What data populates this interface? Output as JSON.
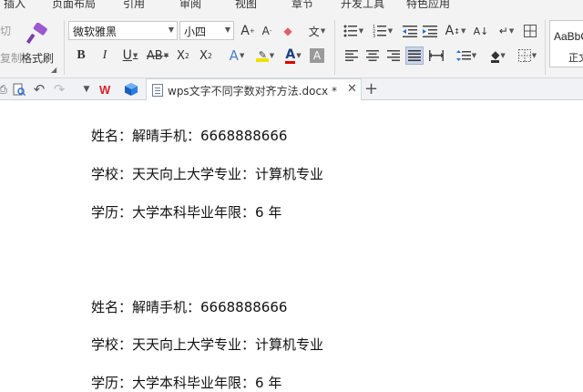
{
  "menu": [
    "插入",
    "页面布局",
    "引用",
    "审阅",
    "视图",
    "章节",
    "开发工具",
    "特色应用"
  ],
  "clipboard": {
    "cut": "切",
    "copy": "复制",
    "format_painter": "格式刷"
  },
  "font": {
    "name": "微软雅黑",
    "size": "小四"
  },
  "styles": {
    "preview": "AaBbC",
    "normal": "正文"
  },
  "document_tab": {
    "title": "wps文字不同字数对齐方法.docx *"
  },
  "document": {
    "lines": [
      "姓名：解晴手机：6668888666",
      "学校：天天向上大学专业：计算机专业",
      "学历：大学本科毕业年限：6 年",
      "姓名：解晴手机：6668888666",
      "学校：天天向上大学专业：计算机专业",
      "学历：大学本科毕业年限：6 年"
    ]
  },
  "colors": {
    "highlight": "#f0e000",
    "font_color": "#e00000",
    "wps_red": "#d9232a",
    "cube_blue": "#2a7de1",
    "brush_purple": "#9b59d0"
  }
}
